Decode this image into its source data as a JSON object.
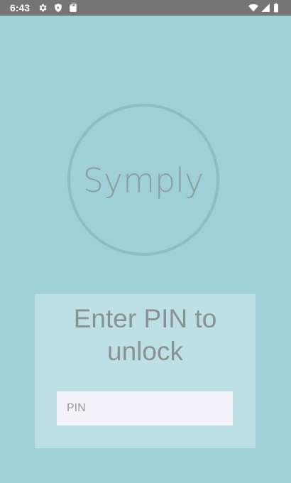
{
  "status_bar": {
    "time": "6:43",
    "left_icons": [
      "gear-icon",
      "shield-icon",
      "sd-card-icon"
    ],
    "right_icons": [
      "wifi-icon",
      "signal-icon",
      "battery-icon"
    ]
  },
  "logo": {
    "text": "Symply"
  },
  "unlock": {
    "title": "Enter PIN to unlock",
    "pin_value": "",
    "pin_placeholder": "PIN"
  },
  "colors": {
    "background": "#9fcfd7",
    "status_bar": "#757575",
    "circle_stroke": "#8cbcc4",
    "card_background": "#bde0e6",
    "input_background": "#f4f3f9",
    "text": "#8a9193"
  }
}
